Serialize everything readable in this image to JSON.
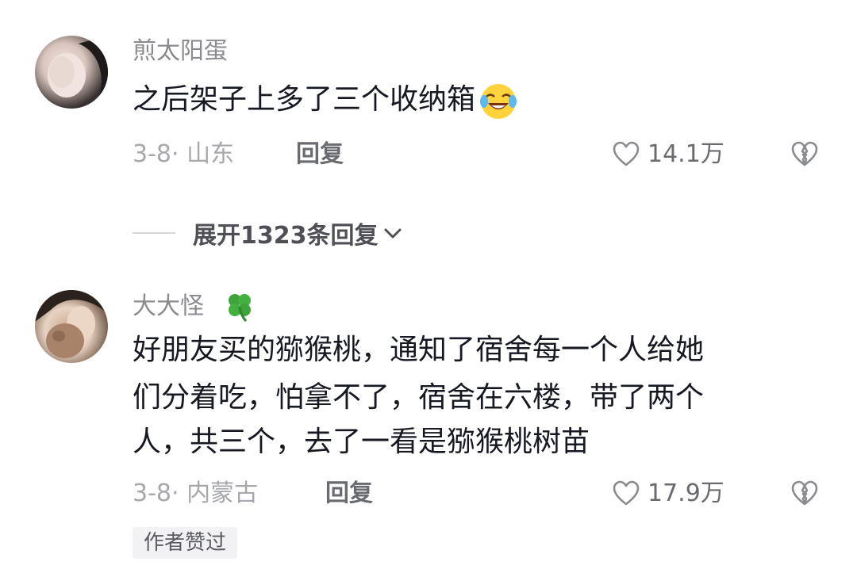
{
  "comments": [
    {
      "username": "煎太阳蛋",
      "text": "之后架子上多了三个收纳箱",
      "emoji": "laughing-crying-emoji",
      "date": "3-8",
      "location": "· 山东",
      "reply_label": "回复",
      "likes": "14.1万"
    },
    {
      "username": "大大怪",
      "name_icon": "four-leaf-clover-emoji",
      "text_lines": [
        "好朋友买的猕猴桃，通知了宿舍每一个人给她",
        "们分着吃，怕拿不了，宿舍在六楼，带了两个",
        "人，共三个，去了一看是猕猴桃树苗"
      ],
      "date": "3-8",
      "location": "· 内蒙古",
      "reply_label": "回复",
      "likes": "17.9万",
      "badge": "作者赞过"
    }
  ],
  "expand_replies": "展开1323条回复",
  "colors": {
    "text": "#161823",
    "secondary": "#8a8b91",
    "muted": "#a7a8ad"
  }
}
